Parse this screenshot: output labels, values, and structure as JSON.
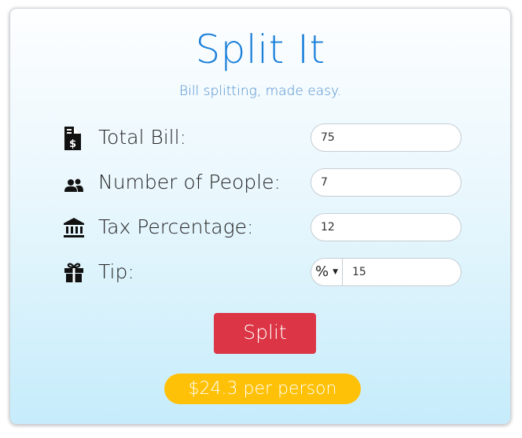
{
  "app": {
    "title": "Split It",
    "subtitle": "Bill splitting, made easy."
  },
  "form": {
    "total_bill": {
      "label": "Total Bill:",
      "value": "75",
      "icon": "invoice-dollar-icon"
    },
    "people": {
      "label": "Number of People:",
      "value": "7",
      "icon": "users-icon"
    },
    "tax": {
      "label": "Tax Percentage:",
      "value": "12",
      "icon": "bank-icon"
    },
    "tip": {
      "label": "Tip:",
      "mode": "%",
      "value": "15",
      "icon": "gift-icon"
    }
  },
  "actions": {
    "split_label": "Split"
  },
  "result": {
    "text": "$24.3 per person"
  },
  "colors": {
    "title": "#1a7fd9",
    "button": "#dc3545",
    "result_badge": "#ffc107"
  }
}
